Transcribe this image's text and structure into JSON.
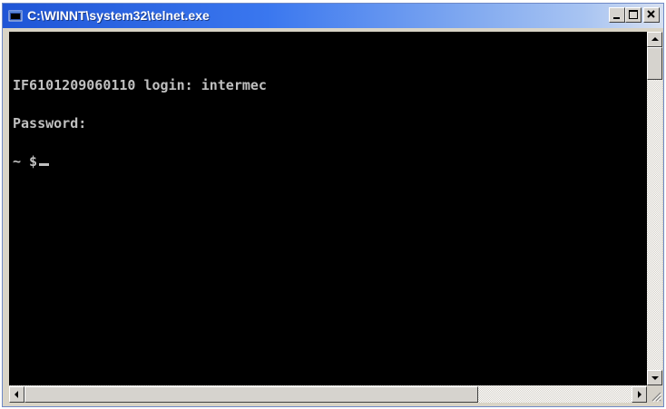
{
  "window": {
    "title": "C:\\WINNT\\system32\\telnet.exe",
    "titlebar_color": "#1f55d6"
  },
  "title_buttons": {
    "minimize": "minimize-icon",
    "maximize": "maximize-icon",
    "close": "close-icon"
  },
  "terminal": {
    "background": "#000000",
    "text_color": "#c0c0c0",
    "lines": [
      "IF6101209060110 login: intermec",
      "Password:",
      "~ $"
    ]
  },
  "scrollbars": {
    "vertical_thumb_position": 0,
    "horizontal_thumb_position": 0
  }
}
